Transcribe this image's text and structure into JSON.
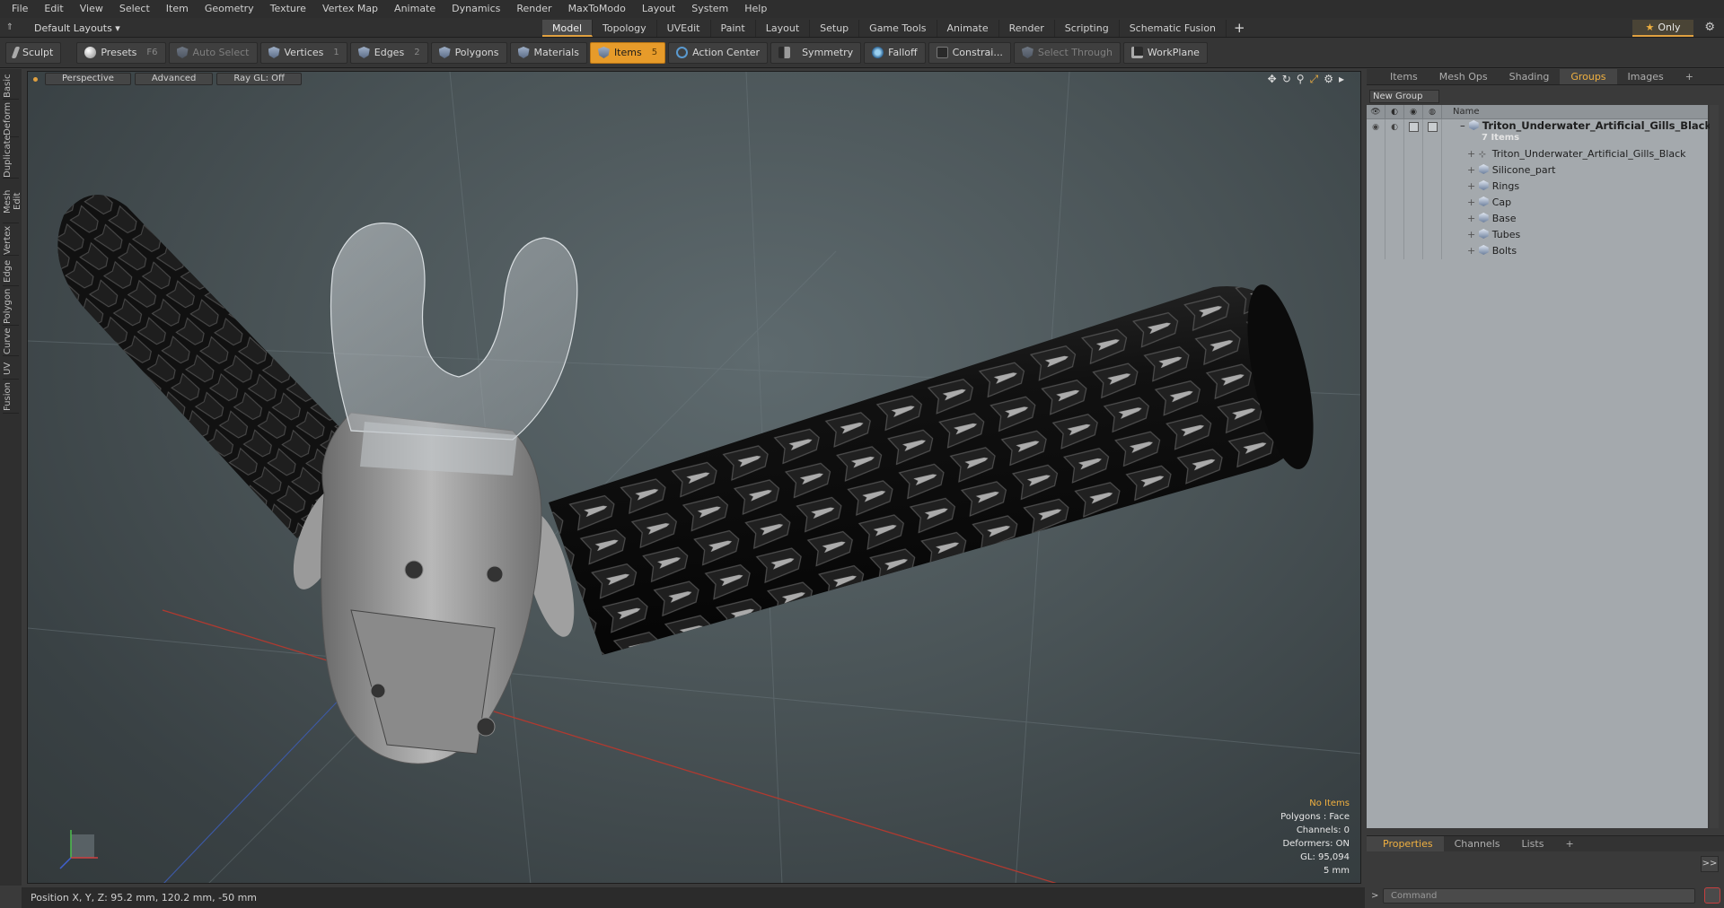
{
  "menu": [
    "File",
    "Edit",
    "View",
    "Select",
    "Item",
    "Geometry",
    "Texture",
    "Vertex Map",
    "Animate",
    "Dynamics",
    "Render",
    "MaxToModo",
    "Layout",
    "System",
    "Help"
  ],
  "layout_dropdown": "Default Layouts ▾",
  "layout_tabs": [
    "Model",
    "Topology",
    "UVEdit",
    "Paint",
    "Layout",
    "Setup",
    "Game Tools",
    "Animate",
    "Render",
    "Scripting",
    "Schematic Fusion"
  ],
  "active_layout_tab": "Model",
  "only_label": "Only",
  "toolbar": {
    "sculpt": "Sculpt",
    "presets": "Presets",
    "presets_key": "F6",
    "auto_select": "Auto Select",
    "vertices": "Vertices",
    "vertices_count": "1",
    "edges": "Edges",
    "edges_count": "2",
    "polygons": "Polygons",
    "materials": "Materials",
    "items": "Items",
    "items_count": "5",
    "action_center": "Action Center",
    "symmetry": "Symmetry",
    "falloff": "Falloff",
    "constraints": "Constrai...",
    "select_through": "Select Through",
    "workplane": "WorkPlane"
  },
  "left_tabs": [
    "Basic",
    "Deform",
    "Duplicate",
    "Mesh Edit",
    "Vertex",
    "Edge",
    "Polygon",
    "Curve",
    "UV",
    "Fusion"
  ],
  "viewport": {
    "view_mode": "Perspective",
    "shading": "Advanced",
    "raygl": "Ray GL: Off",
    "info": {
      "no_items": "No Items",
      "polygons": "Polygons : Face",
      "channels": "Channels: 0",
      "deformers": "Deformers: ON",
      "gl": "GL: 95,094",
      "unit": "5 mm"
    }
  },
  "status": "Position X, Y, Z:  95.2 mm, 120.2 mm, -50 mm",
  "right_panel": {
    "tabs": [
      "Items",
      "Mesh Ops",
      "Shading",
      "Groups",
      "Images"
    ],
    "active_tab": "Groups",
    "new_group": "New Group",
    "name_header": "Name",
    "group_name": "Triton_Underwater_Artificial_Gills_Black",
    "group_count": "7 Items",
    "children": [
      {
        "name": "Triton_Underwater_Artificial_Gills_Black",
        "icon": "locator-icon"
      },
      {
        "name": "Silicone_part",
        "icon": "mesh-icon"
      },
      {
        "name": "Rings",
        "icon": "mesh-icon"
      },
      {
        "name": "Cap",
        "icon": "mesh-icon"
      },
      {
        "name": "Base",
        "icon": "mesh-icon"
      },
      {
        "name": "Tubes",
        "icon": "mesh-icon"
      },
      {
        "name": "Bolts",
        "icon": "mesh-icon"
      }
    ],
    "bottom_tabs": [
      "Properties",
      "Channels",
      "Lists"
    ],
    "active_bottom_tab": "Properties",
    "command_placeholder": "Command"
  },
  "colors": {
    "accent": "#e79b2a",
    "active_tab_text": "#f0b040"
  }
}
